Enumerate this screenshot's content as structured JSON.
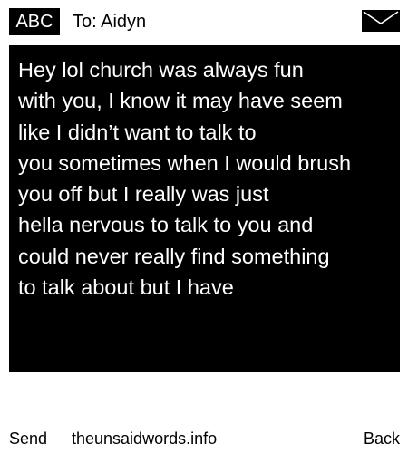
{
  "header": {
    "input_mode": "ABC",
    "recipient": "To: Aidyn",
    "icon": "envelope-icon"
  },
  "message": {
    "text": "Hey lol church was always fun\nwith you, I know it may have seem\nlike I didn’t want to talk to\nyou sometimes when I would brush\nyou off but I really was just\nhella nervous to talk to you and\ncould never really find something\nto talk about but I have"
  },
  "softkeys": {
    "send_label": "Send",
    "site_label": "theunsaidwords.info",
    "back_label": "Back"
  },
  "colors": {
    "background": "#ffffff",
    "message_background": "#000000",
    "message_text": "#ffffff"
  }
}
